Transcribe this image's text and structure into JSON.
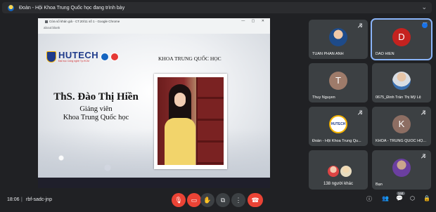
{
  "topbar": {
    "title": "Đoàn - Hội Khoa Trung Quốc học đang trình bày"
  },
  "browser": {
    "tab_title": "Cửa sổ khán giả - CT.20/11 số 1 - Google Chrome",
    "url": "about:blank",
    "window_buttons": "—  ▢  ✕"
  },
  "slide": {
    "logo_text": "HUTECH",
    "logo_sub": "Đại học Công nghệ Tp.HCM",
    "department": "KHOA TRUNG QUỐC HỌC",
    "lecturer_name": "ThS. Đào Thị Hiền",
    "role": "Giảng viên",
    "faculty": "Khoa Trung Quốc học"
  },
  "participants": [
    {
      "name": "TUAN PHAN ANH",
      "avatar_type": "photo",
      "muted": true
    },
    {
      "name": "DAO HIEN",
      "avatar_letter": "D",
      "speaking": true,
      "avatar_color": "#c5221f"
    },
    {
      "name": "Thuy Nguyen",
      "avatar_letter": "T",
      "muted": false,
      "avatar_color": "#9e7b6a"
    },
    {
      "name": "0675_Đinh Trần Thị Mỹ Lệ",
      "avatar_type": "photo",
      "muted": false
    },
    {
      "name": "Đoàn - Hội Khoa Trung Qu...",
      "avatar_type": "logo",
      "avatar_text": "HUTECH",
      "muted": true
    },
    {
      "name": "KHOA - TRUNG QUỐC HỌ...",
      "avatar_letter": "K",
      "muted": true,
      "avatar_color": "#8d6e63"
    },
    {
      "others_label": "138 người khác"
    },
    {
      "name": "Bạn",
      "avatar_type": "photo",
      "muted": true
    }
  ],
  "bottombar": {
    "time": "18:06",
    "separator": "|",
    "meeting_code": "rbf-sadc-jnp",
    "participant_count": "144",
    "icons": {
      "mic": "mic-off-icon",
      "camera": "camera-off-icon",
      "hand": "raise-hand-icon",
      "present": "present-screen-icon",
      "more": "more-options-icon",
      "end": "end-call-icon",
      "info": "info-icon",
      "people": "people-icon",
      "chat": "chat-icon",
      "activities": "activities-icon",
      "host": "host-controls-icon"
    }
  },
  "colors": {
    "background": "#202124",
    "tile": "#3c4043",
    "danger": "#ea4335",
    "accent": "#8ab4f8"
  }
}
